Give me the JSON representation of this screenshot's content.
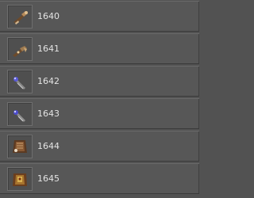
{
  "items": [
    {
      "label": "1640",
      "icon": "weapon-icon"
    },
    {
      "label": "1641",
      "icon": "weapon-icon"
    },
    {
      "label": "1642",
      "icon": "orb-staff-icon"
    },
    {
      "label": "1643",
      "icon": "orb-staff-icon"
    },
    {
      "label": "1644",
      "icon": "armor-icon"
    },
    {
      "label": "1645",
      "icon": "armor-icon"
    }
  ]
}
